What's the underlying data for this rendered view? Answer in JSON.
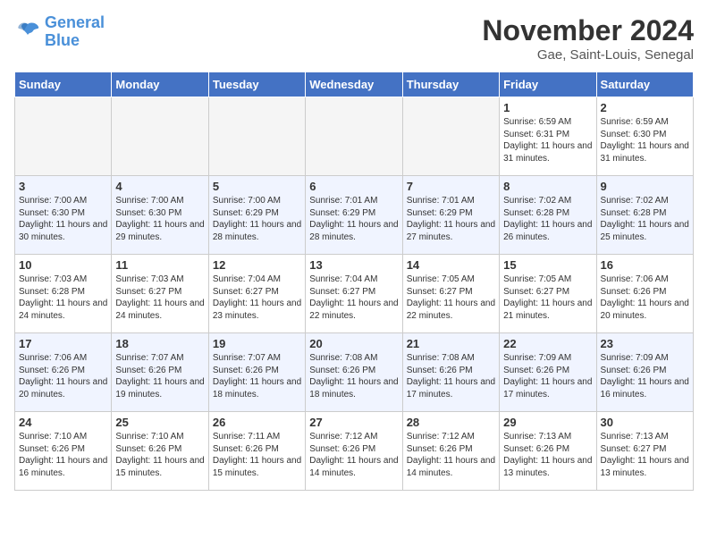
{
  "header": {
    "logo_line1": "General",
    "logo_line2": "Blue",
    "month": "November 2024",
    "location": "Gae, Saint-Louis, Senegal"
  },
  "days_of_week": [
    "Sunday",
    "Monday",
    "Tuesday",
    "Wednesday",
    "Thursday",
    "Friday",
    "Saturday"
  ],
  "weeks": [
    [
      {
        "day": "",
        "empty": true
      },
      {
        "day": "",
        "empty": true
      },
      {
        "day": "",
        "empty": true
      },
      {
        "day": "",
        "empty": true
      },
      {
        "day": "",
        "empty": true
      },
      {
        "day": "1",
        "sunrise": "6:59 AM",
        "sunset": "6:31 PM",
        "daylight": "11 hours and 31 minutes."
      },
      {
        "day": "2",
        "sunrise": "6:59 AM",
        "sunset": "6:30 PM",
        "daylight": "11 hours and 31 minutes."
      }
    ],
    [
      {
        "day": "3",
        "sunrise": "7:00 AM",
        "sunset": "6:30 PM",
        "daylight": "11 hours and 30 minutes."
      },
      {
        "day": "4",
        "sunrise": "7:00 AM",
        "sunset": "6:30 PM",
        "daylight": "11 hours and 29 minutes."
      },
      {
        "day": "5",
        "sunrise": "7:00 AM",
        "sunset": "6:29 PM",
        "daylight": "11 hours and 28 minutes."
      },
      {
        "day": "6",
        "sunrise": "7:01 AM",
        "sunset": "6:29 PM",
        "daylight": "11 hours and 28 minutes."
      },
      {
        "day": "7",
        "sunrise": "7:01 AM",
        "sunset": "6:29 PM",
        "daylight": "11 hours and 27 minutes."
      },
      {
        "day": "8",
        "sunrise": "7:02 AM",
        "sunset": "6:28 PM",
        "daylight": "11 hours and 26 minutes."
      },
      {
        "day": "9",
        "sunrise": "7:02 AM",
        "sunset": "6:28 PM",
        "daylight": "11 hours and 25 minutes."
      }
    ],
    [
      {
        "day": "10",
        "sunrise": "7:03 AM",
        "sunset": "6:28 PM",
        "daylight": "11 hours and 24 minutes."
      },
      {
        "day": "11",
        "sunrise": "7:03 AM",
        "sunset": "6:27 PM",
        "daylight": "11 hours and 24 minutes."
      },
      {
        "day": "12",
        "sunrise": "7:04 AM",
        "sunset": "6:27 PM",
        "daylight": "11 hours and 23 minutes."
      },
      {
        "day": "13",
        "sunrise": "7:04 AM",
        "sunset": "6:27 PM",
        "daylight": "11 hours and 22 minutes."
      },
      {
        "day": "14",
        "sunrise": "7:05 AM",
        "sunset": "6:27 PM",
        "daylight": "11 hours and 22 minutes."
      },
      {
        "day": "15",
        "sunrise": "7:05 AM",
        "sunset": "6:27 PM",
        "daylight": "11 hours and 21 minutes."
      },
      {
        "day": "16",
        "sunrise": "7:06 AM",
        "sunset": "6:26 PM",
        "daylight": "11 hours and 20 minutes."
      }
    ],
    [
      {
        "day": "17",
        "sunrise": "7:06 AM",
        "sunset": "6:26 PM",
        "daylight": "11 hours and 20 minutes."
      },
      {
        "day": "18",
        "sunrise": "7:07 AM",
        "sunset": "6:26 PM",
        "daylight": "11 hours and 19 minutes."
      },
      {
        "day": "19",
        "sunrise": "7:07 AM",
        "sunset": "6:26 PM",
        "daylight": "11 hours and 18 minutes."
      },
      {
        "day": "20",
        "sunrise": "7:08 AM",
        "sunset": "6:26 PM",
        "daylight": "11 hours and 18 minutes."
      },
      {
        "day": "21",
        "sunrise": "7:08 AM",
        "sunset": "6:26 PM",
        "daylight": "11 hours and 17 minutes."
      },
      {
        "day": "22",
        "sunrise": "7:09 AM",
        "sunset": "6:26 PM",
        "daylight": "11 hours and 17 minutes."
      },
      {
        "day": "23",
        "sunrise": "7:09 AM",
        "sunset": "6:26 PM",
        "daylight": "11 hours and 16 minutes."
      }
    ],
    [
      {
        "day": "24",
        "sunrise": "7:10 AM",
        "sunset": "6:26 PM",
        "daylight": "11 hours and 16 minutes."
      },
      {
        "day": "25",
        "sunrise": "7:10 AM",
        "sunset": "6:26 PM",
        "daylight": "11 hours and 15 minutes."
      },
      {
        "day": "26",
        "sunrise": "7:11 AM",
        "sunset": "6:26 PM",
        "daylight": "11 hours and 15 minutes."
      },
      {
        "day": "27",
        "sunrise": "7:12 AM",
        "sunset": "6:26 PM",
        "daylight": "11 hours and 14 minutes."
      },
      {
        "day": "28",
        "sunrise": "7:12 AM",
        "sunset": "6:26 PM",
        "daylight": "11 hours and 14 minutes."
      },
      {
        "day": "29",
        "sunrise": "7:13 AM",
        "sunset": "6:26 PM",
        "daylight": "11 hours and 13 minutes."
      },
      {
        "day": "30",
        "sunrise": "7:13 AM",
        "sunset": "6:27 PM",
        "daylight": "11 hours and 13 minutes."
      }
    ]
  ]
}
